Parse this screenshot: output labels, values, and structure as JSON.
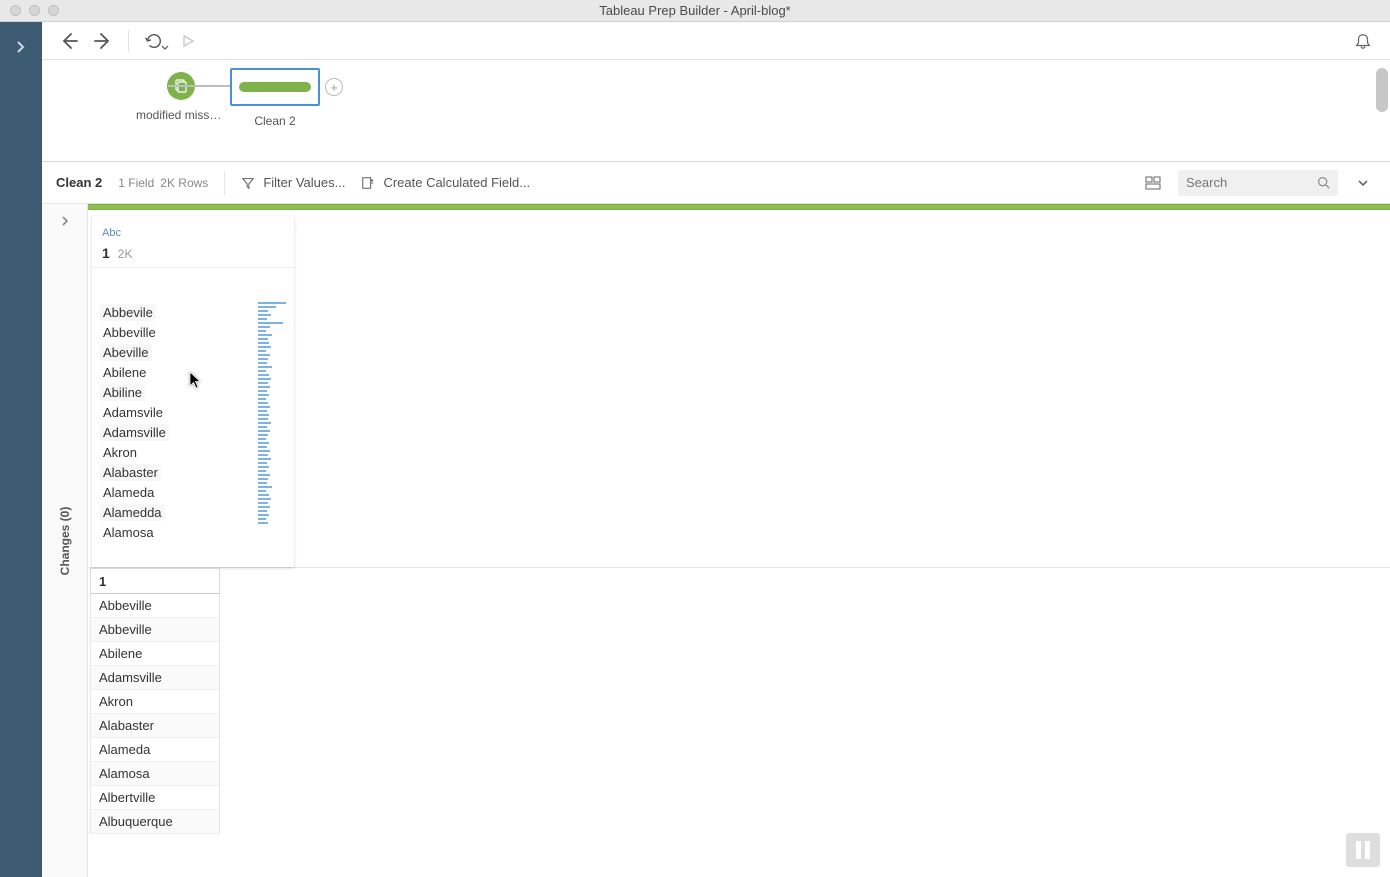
{
  "title": "Tableau Prep Builder - April-blog*",
  "flow": {
    "input_node_label": "modified missp...",
    "clean_node_label": "Clean 2"
  },
  "step": {
    "name": "Clean 2",
    "fields_label": "1 Field",
    "rows_label": "2K Rows",
    "filter_label": "Filter Values...",
    "calc_label": "Create Calculated Field..."
  },
  "search": {
    "placeholder": "Search"
  },
  "changes": {
    "label": "Changes (0)"
  },
  "profile": {
    "type_badge": "Abc",
    "field_name": "1",
    "value_count": "2K",
    "values": [
      "Abbevile",
      "Abbeville",
      "Abeville",
      "Abilene",
      "Abiline",
      "Adamsvile",
      "Adamsville",
      "Akron",
      "Alabaster",
      "Alameda",
      "Alamedda",
      "Alamosa"
    ]
  },
  "grid": {
    "column": "1",
    "rows": [
      "Abbeville",
      "Abbeville",
      "Abilene",
      "Adamsville",
      "Akron",
      "Alabaster",
      "Alameda",
      "Alamosa",
      "Albertville",
      "Albuquerque"
    ]
  }
}
